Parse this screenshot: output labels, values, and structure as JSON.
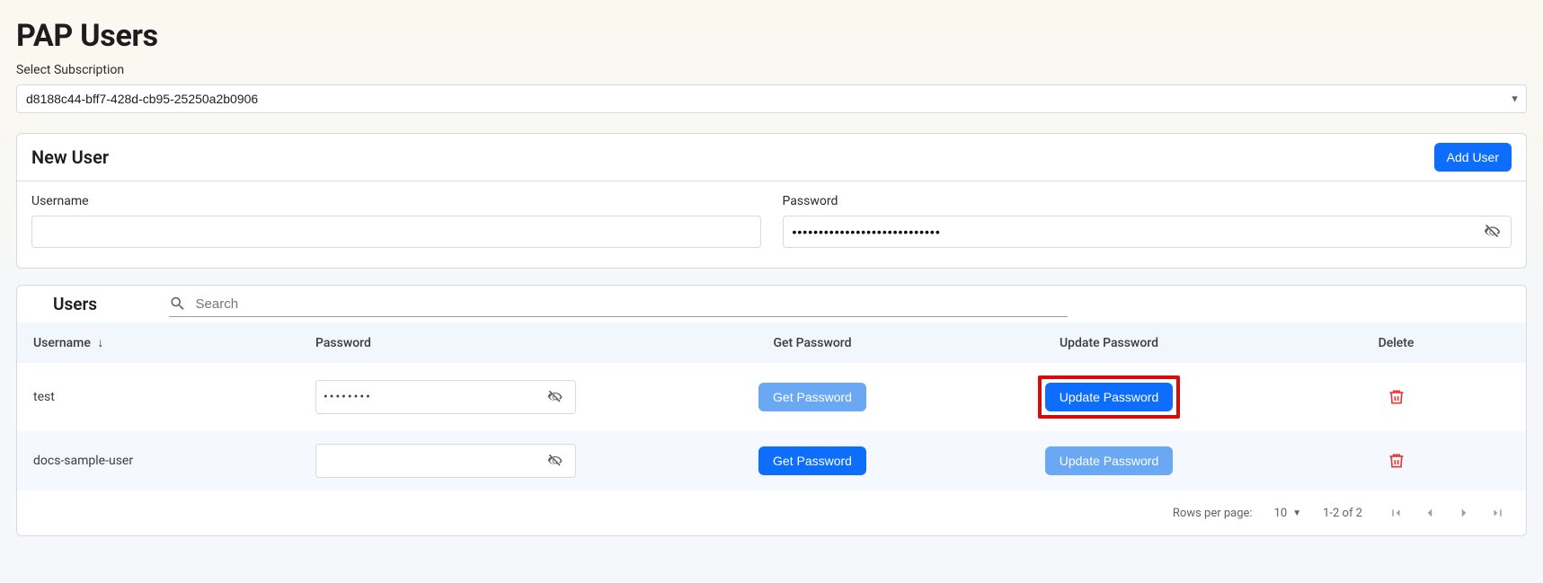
{
  "page_title": "PAP Users",
  "subscription": {
    "label": "Select Subscription",
    "value": "d8188c44-bff7-428d-cb95-25250a2b0906"
  },
  "new_user": {
    "title": "New User",
    "add_button": "Add User",
    "username_label": "Username",
    "username_value": "",
    "password_label": "Password",
    "password_value": "••••••••••••••••••••••••••••"
  },
  "users_section": {
    "title": "Users",
    "search_placeholder": "Search"
  },
  "table": {
    "columns": {
      "username": "Username",
      "password": "Password",
      "get": "Get Password",
      "update": "Update Password",
      "delete": "Delete"
    },
    "rows": [
      {
        "username": "test",
        "password_display": "••••••••",
        "get_label": "Get Password",
        "get_faded": true,
        "update_label": "Update Password",
        "update_faded": false,
        "highlight_update": true
      },
      {
        "username": "docs-sample-user",
        "password_display": "",
        "get_label": "Get Password",
        "get_faded": false,
        "update_label": "Update Password",
        "update_faded": true,
        "highlight_update": false
      }
    ]
  },
  "footer": {
    "rows_label": "Rows per page:",
    "rows_value": "10",
    "range": "1-2 of 2"
  }
}
